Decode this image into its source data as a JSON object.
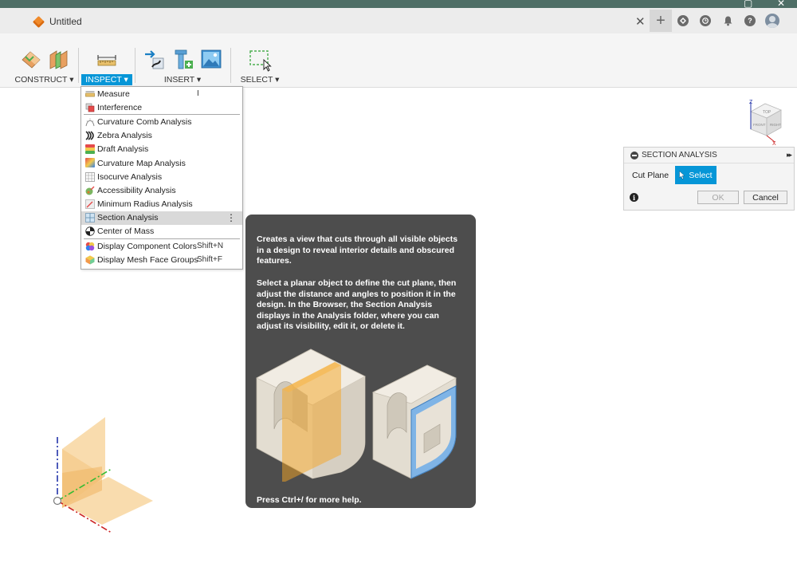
{
  "window": {
    "restore_icon": "restore-icon",
    "close_icon": "close-icon"
  },
  "tab": {
    "title": "Untitled",
    "close_glyph": "✕",
    "icon": "document-cube-icon"
  },
  "tab_right": {
    "new_tab_glyph": "+",
    "help_glyph": "?",
    "icons": [
      "plus-icon",
      "extensions-icon",
      "job-status-icon",
      "notifications-icon",
      "help-icon",
      "avatar"
    ]
  },
  "toolbar": {
    "groups": [
      {
        "label": "CONSTRUCT",
        "arrow": "▾",
        "active": false
      },
      {
        "label": "INSPECT",
        "arrow": "▾",
        "active": true
      },
      {
        "label": "INSERT",
        "arrow": "▾",
        "active": false
      },
      {
        "label": "SELECT",
        "arrow": "▾",
        "active": false
      }
    ]
  },
  "inspect_menu": {
    "items": [
      {
        "label": "Measure",
        "shortcut": "I",
        "icon": "measure-icon"
      },
      {
        "label": "Interference",
        "shortcut": "",
        "icon": "interference-icon"
      },
      {
        "label": "Curvature Comb Analysis",
        "shortcut": "",
        "icon": "curvature-comb-icon"
      },
      {
        "label": "Zebra Analysis",
        "shortcut": "",
        "icon": "zebra-icon"
      },
      {
        "label": "Draft Analysis",
        "shortcut": "",
        "icon": "draft-icon"
      },
      {
        "label": "Curvature Map Analysis",
        "shortcut": "",
        "icon": "curvature-map-icon"
      },
      {
        "label": "Isocurve Analysis",
        "shortcut": "",
        "icon": "isocurve-icon"
      },
      {
        "label": "Accessibility Analysis",
        "shortcut": "",
        "icon": "accessibility-icon"
      },
      {
        "label": "Minimum Radius Analysis",
        "shortcut": "",
        "icon": "minimum-radius-icon"
      },
      {
        "label": "Section Analysis",
        "shortcut": "",
        "icon": "section-analysis-icon",
        "highlighted": true
      },
      {
        "label": "Center of Mass",
        "shortcut": "",
        "icon": "center-of-mass-icon"
      },
      {
        "label": "Display Component Colors",
        "shortcut": "Shift+N",
        "icon": "component-colors-icon"
      },
      {
        "label": "Display Mesh Face Groups",
        "shortcut": "Shift+F",
        "icon": "mesh-face-groups-icon"
      }
    ],
    "more_glyph": "⋮"
  },
  "tooltip": {
    "paragraph_1": "Creates a view that cuts through all visible objects in a design to reveal interior details and obscured features.",
    "paragraph_2": "Select a planar object to define the cut plane, then adjust the distance and angles to position it in the design. In the Browser, the Section Analysis displays in the Analysis folder, where you can adjust its visibility, edit it, or delete it.",
    "help": "Press Ctrl+/ for more help."
  },
  "section_panel": {
    "title": "SECTION ANALYSIS",
    "expand_glyph": "▸▸",
    "cut_plane_label": "Cut Plane",
    "select_label": "Select",
    "info_glyph": "i",
    "ok_label": "OK",
    "cancel_label": "Cancel"
  },
  "viewcube": {
    "axis_z": "Z",
    "axis_x": "X",
    "face_top": "TOP",
    "face_front": "FRONT",
    "face_right": "RIGHT"
  },
  "colors": {
    "accent": "#0696d7",
    "tooltip_bg": "#4d4d4d",
    "title_strip": "#4e6e66"
  }
}
